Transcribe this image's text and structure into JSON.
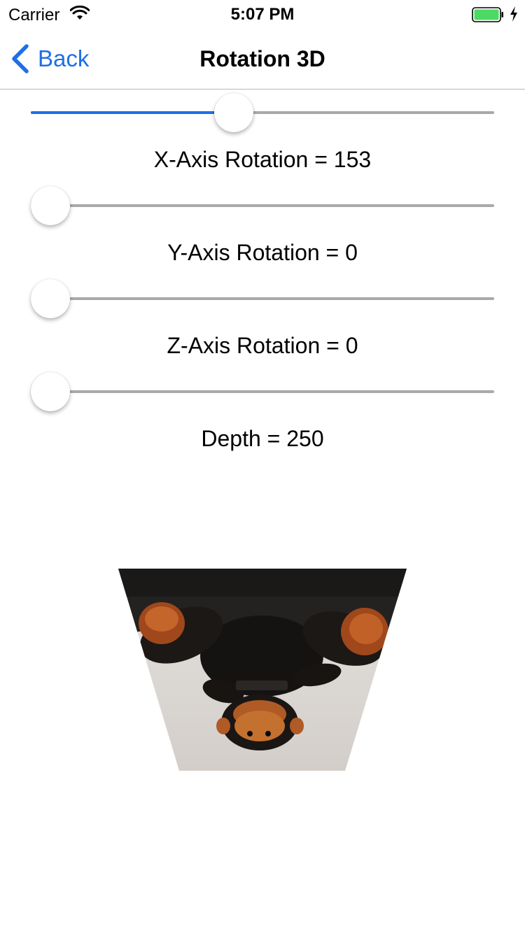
{
  "status_bar": {
    "carrier": "Carrier",
    "time": "5:07 PM",
    "wifi_icon": "wifi-icon",
    "battery_icon": "battery-charging-icon"
  },
  "nav": {
    "back_label": "Back",
    "title": "Rotation 3D"
  },
  "controls": [
    {
      "label": "X-Axis Rotation = 153",
      "value": 153,
      "fraction": 0.432
    },
    {
      "label": "Y-Axis Rotation = 0",
      "value": 0,
      "fraction": 0.0
    },
    {
      "label": "Z-Axis Rotation = 0",
      "value": 0,
      "fraction": 0.0
    },
    {
      "label": "Depth = 250",
      "value": 250,
      "fraction": 0.0
    }
  ],
  "colors": {
    "accent": "#1f6fe6",
    "track": "#a9a9ab",
    "battery": "#4cd964"
  }
}
